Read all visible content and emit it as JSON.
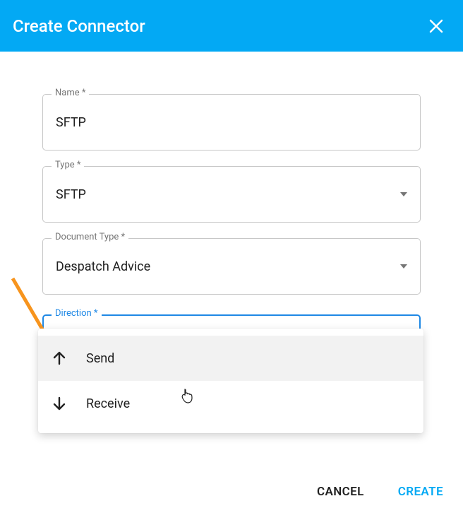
{
  "dialog": {
    "title": "Create Connector"
  },
  "fields": {
    "name": {
      "label": "Name *",
      "value": "SFTP"
    },
    "type": {
      "label": "Type *",
      "value": "SFTP"
    },
    "documentType": {
      "label": "Document Type *",
      "value": "Despatch Advice"
    },
    "direction": {
      "label": "Direction *",
      "options": {
        "send": "Send",
        "receive": "Receive"
      }
    }
  },
  "buttons": {
    "cancel": "CANCEL",
    "create": "CREATE"
  }
}
